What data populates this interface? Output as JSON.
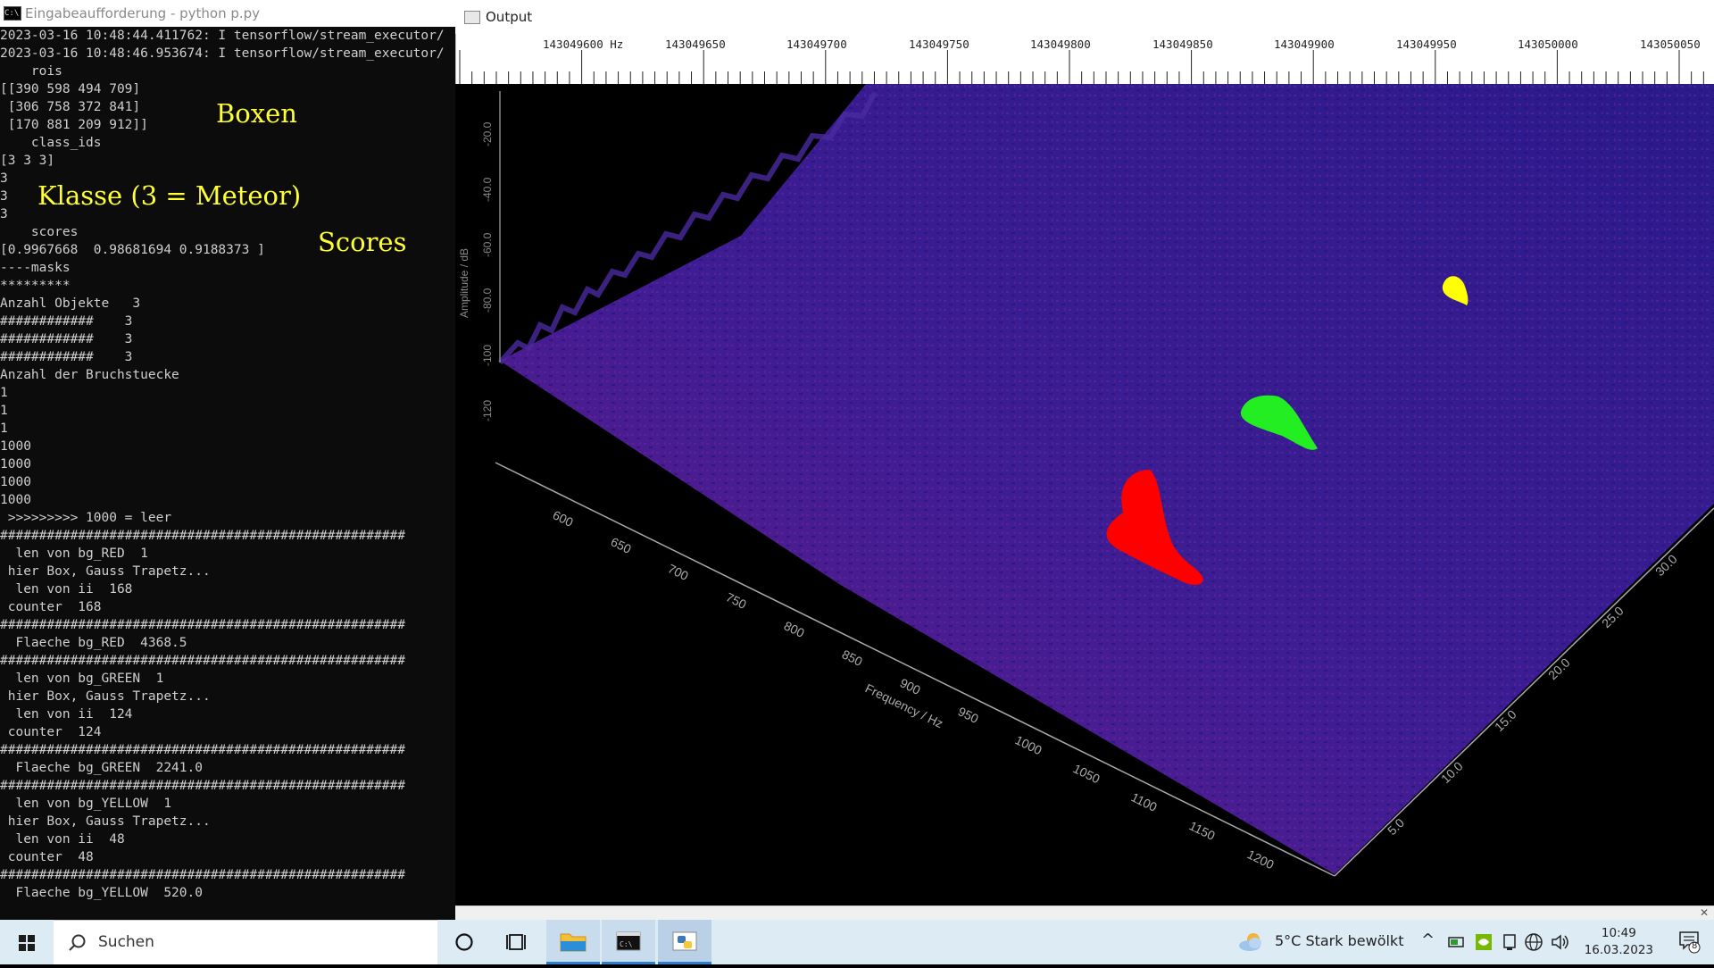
{
  "console": {
    "title": "Eingabeaufforderung - python  p.py",
    "icon_label": "C:\\",
    "lines": [
      "2023-03-16 10:48:44.411762: I tensorflow/stream_executor/",
      "2023-03-16 10:48:46.953674: I tensorflow/stream_executor/",
      "    rois",
      "[[390 598 494 709]",
      " [306 758 372 841]",
      " [170 881 209 912]]",
      "    class_ids",
      "[3 3 3]",
      "3",
      "3",
      "3",
      "    scores",
      "[0.9967668  0.98681694 0.9188373 ]",
      "----masks",
      "*********",
      "Anzahl Objekte   3",
      "############    3",
      "############    3",
      "############    3",
      "Anzahl der Bruchstuecke",
      "1",
      "1",
      "1",
      "1000",
      "1000",
      "1000",
      "1000",
      " >>>>>>>>> 1000 = leer",
      "####################################################",
      "  len von bg_RED  1",
      " hier Box, Gauss Trapetz...",
      "  len von ii  168",
      " counter  168",
      "####################################################",
      "  Flaeche bg_RED  4368.5",
      "####################################################",
      "  len von bg_GREEN  1",
      " hier Box, Gauss Trapetz...",
      "  len von ii  124",
      " counter  124",
      "####################################################",
      "  Flaeche bg_GREEN  2241.0",
      "####################################################",
      "  len von bg_YELLOW  1",
      " hier Box, Gauss Trapetz...",
      "  len von ii  48",
      " counter  48",
      "####################################################",
      "  Flaeche bg_YELLOW  520.0"
    ],
    "annotations": {
      "boxen": "Boxen",
      "klasse": "Klasse (3 = Meteor)",
      "scores": "Scores"
    }
  },
  "output": {
    "title": "Output",
    "ruler_labels": [
      "143049600 Hz",
      "143049650",
      "143049700",
      "143049750",
      "143049800",
      "143049850",
      "143049900",
      "143049950",
      "143050000",
      "143050050"
    ],
    "plot": {
      "amplitude_axis_label": "Amplitude / dB",
      "amplitude_ticks": [
        "-20.0",
        "-40.0",
        "-60.0",
        "-80.0",
        "-100",
        "-120"
      ],
      "frequency_axis_label": "Frequency / Hz",
      "frequency_ticks": [
        "600",
        "650",
        "700",
        "750",
        "800",
        "850",
        "900",
        "950",
        "1000",
        "1050",
        "1100",
        "1150",
        "1200"
      ],
      "time_ticks": [
        "5.0",
        "10.0",
        "15.0",
        "20.0",
        "25.0",
        "30.0"
      ],
      "surface_color": "#3a1a8c",
      "detections": [
        {
          "name": "red-detection",
          "color": "#ff0000"
        },
        {
          "name": "green-detection",
          "color": "#22ee22"
        },
        {
          "name": "yellow-detection",
          "color": "#ffff00"
        }
      ]
    }
  },
  "taskbar": {
    "search_placeholder": "Suchen",
    "weather": "5°C  Stark bewölkt",
    "time": "10:49",
    "date": "16.03.2023",
    "notification_count": "8"
  }
}
